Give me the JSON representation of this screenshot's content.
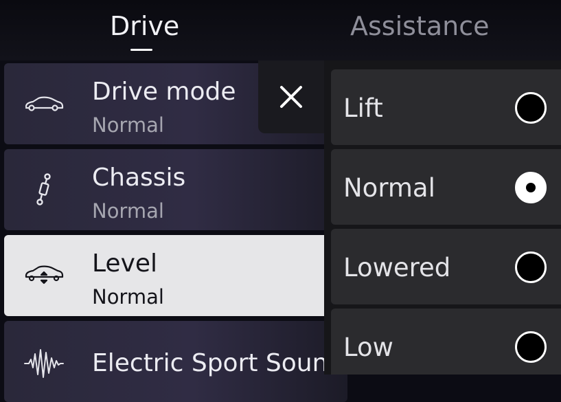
{
  "tabs": [
    {
      "label": "Drive",
      "active": true
    },
    {
      "label": "Assistance",
      "active": false
    }
  ],
  "settings": [
    {
      "title": "Drive mode",
      "value": "Normal",
      "icon": "car-icon",
      "selected": false
    },
    {
      "title": "Chassis",
      "value": "Normal",
      "icon": "shock-absorber-icon",
      "selected": false
    },
    {
      "title": "Level",
      "value": "Normal",
      "icon": "car-level-icon",
      "selected": true
    },
    {
      "title": "Electric Sport Sound",
      "value": "",
      "icon": "sound-wave-icon",
      "selected": false
    }
  ],
  "close": {
    "icon": "close-icon"
  },
  "level_options": [
    {
      "label": "Lift",
      "selected": false
    },
    {
      "label": "Normal",
      "selected": true
    },
    {
      "label": "Lowered",
      "selected": false
    },
    {
      "label": "Low",
      "selected": false
    }
  ],
  "colors": {
    "background": "#0c0c14",
    "selected_item": "#e6e6e8",
    "panel": "#161619",
    "option": "#2b2b2e",
    "inactive_tab": "#8f8f9a"
  }
}
